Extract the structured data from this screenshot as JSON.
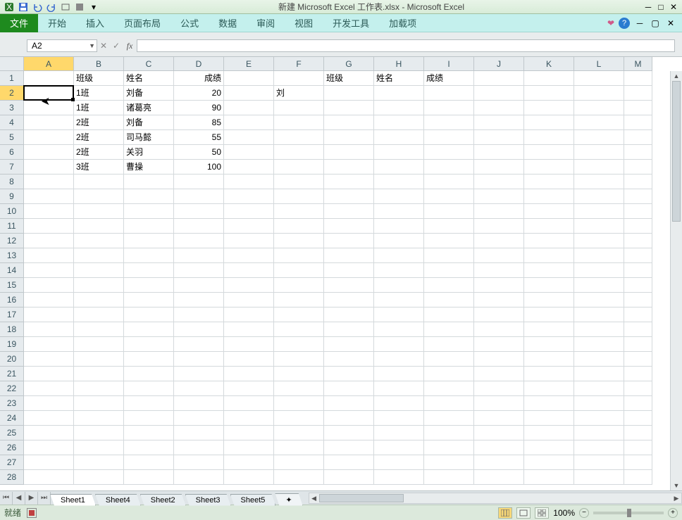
{
  "title": "新建 Microsoft Excel 工作表.xlsx - Microsoft Excel",
  "ribbon": {
    "file": "文件",
    "tabs": [
      "开始",
      "插入",
      "页面布局",
      "公式",
      "数据",
      "审阅",
      "视图",
      "开发工具",
      "加载项"
    ]
  },
  "namebox": "A2",
  "fx_label": "fx",
  "columns": [
    "A",
    "B",
    "C",
    "D",
    "E",
    "F",
    "G",
    "H",
    "I",
    "J",
    "K",
    "L",
    "M"
  ],
  "row_count": 28,
  "selected_col_index": 0,
  "selected_row_index": 1,
  "cells": {
    "B1": "班级",
    "C1": "姓名",
    "D1": "成绩",
    "G1": "班级",
    "H1": "姓名",
    "I1": "成绩",
    "B2": "1班",
    "C2": "刘备",
    "D2": "20",
    "F2": "刘",
    "B3": "1班",
    "C3": "诸葛亮",
    "D3": "90",
    "B4": "2班",
    "C4": "刘备",
    "D4": "85",
    "B5": "2班",
    "C5": "司马懿",
    "D5": "55",
    "B6": "2班",
    "C6": "关羽",
    "D6": "50",
    "B7": "3班",
    "C7": "曹操",
    "D7": "100"
  },
  "numeric_cols": [
    "D"
  ],
  "sheets": [
    "Sheet1",
    "Sheet4",
    "Sheet2",
    "Sheet3",
    "Sheet5"
  ],
  "active_sheet": 0,
  "status": {
    "ready": "就绪",
    "zoom": "100%"
  }
}
